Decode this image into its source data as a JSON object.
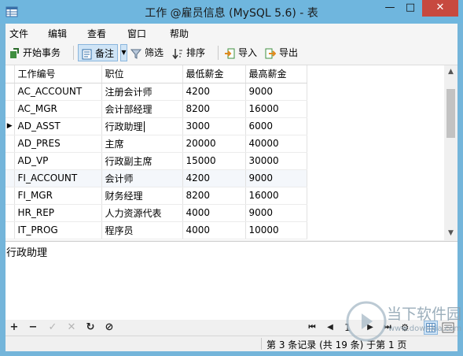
{
  "window": {
    "title": "工作 @雇员信息 (MySQL 5.6) - 表",
    "minimize": "—",
    "maximize": "□",
    "close": "✕"
  },
  "menu": [
    "文件",
    "编辑",
    "查看",
    "窗口",
    "帮助"
  ],
  "toolbar": {
    "begin_transaction": "开始事务",
    "note": "备注",
    "filter": "筛选",
    "sort": "排序",
    "import": "导入",
    "export": "导出"
  },
  "grid": {
    "columns": [
      "工作编号",
      "职位",
      "最低薪金",
      "最高薪金"
    ],
    "rows": [
      [
        "AC_ACCOUNT",
        "注册会计师",
        "4200",
        "9000"
      ],
      [
        "AC_MGR",
        "会计部经理",
        "8200",
        "16000"
      ],
      [
        "AD_ASST",
        "行政助理",
        "3000",
        "6000"
      ],
      [
        "AD_PRES",
        "主席",
        "20000",
        "40000"
      ],
      [
        "AD_VP",
        "行政副主席",
        "15000",
        "30000"
      ],
      [
        "FI_ACCOUNT",
        "会计师",
        "4200",
        "9000"
      ],
      [
        "FI_MGR",
        "财务经理",
        "8200",
        "16000"
      ],
      [
        "HR_REP",
        "人力资源代表",
        "4000",
        "9000"
      ],
      [
        "IT_PROG",
        "程序员",
        "4000",
        "10000"
      ]
    ],
    "current_row_marker": "▶"
  },
  "detail": {
    "text": "行政助理"
  },
  "navbar": {
    "add": "+",
    "delete": "−",
    "apply": "✓",
    "discard": "✕",
    "refresh": "↻",
    "stop": "⊘",
    "first": "⏮",
    "prev": "◀",
    "page": "1",
    "next": "▶",
    "last": "⏭",
    "settings": "⚙"
  },
  "status": {
    "text": "第 3 条记录 (共 19 条) 于第 1 页"
  },
  "watermark": {
    "brand": "当下软件园",
    "url": "www.downxia.com"
  },
  "colors": {
    "title_bar": "#6fb6de",
    "close": "#c7493f",
    "selection": "#cfe4f6",
    "grid_alt": "#f4f7fb"
  }
}
